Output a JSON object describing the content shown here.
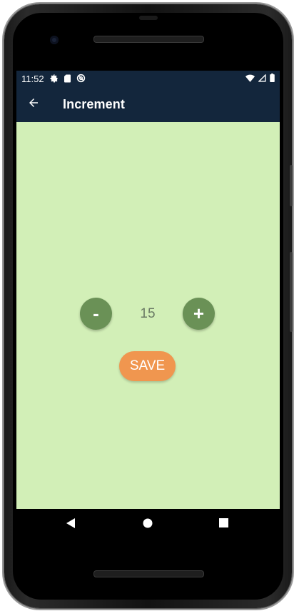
{
  "status_bar": {
    "time": "11:52",
    "left_icons": [
      "gear-icon",
      "sd-card-icon",
      "sync-blocked-icon"
    ],
    "right_icons": [
      "wifi-icon",
      "cell-signal-icon",
      "battery-icon"
    ]
  },
  "app_bar": {
    "title": "Increment",
    "back_icon": "arrow-left-icon"
  },
  "counter": {
    "decrement_label": "-",
    "value": "15",
    "increment_label": "+"
  },
  "actions": {
    "save_label": "SAVE"
  },
  "nav_bar": {
    "items": [
      "back-triangle-icon",
      "home-circle-icon",
      "recents-square-icon"
    ]
  },
  "colors": {
    "app_bar": "#13263c",
    "background": "#d2efb7",
    "round_button": "#6a9156",
    "save_button": "#f0964f",
    "counter_text": "#6a7a64"
  }
}
